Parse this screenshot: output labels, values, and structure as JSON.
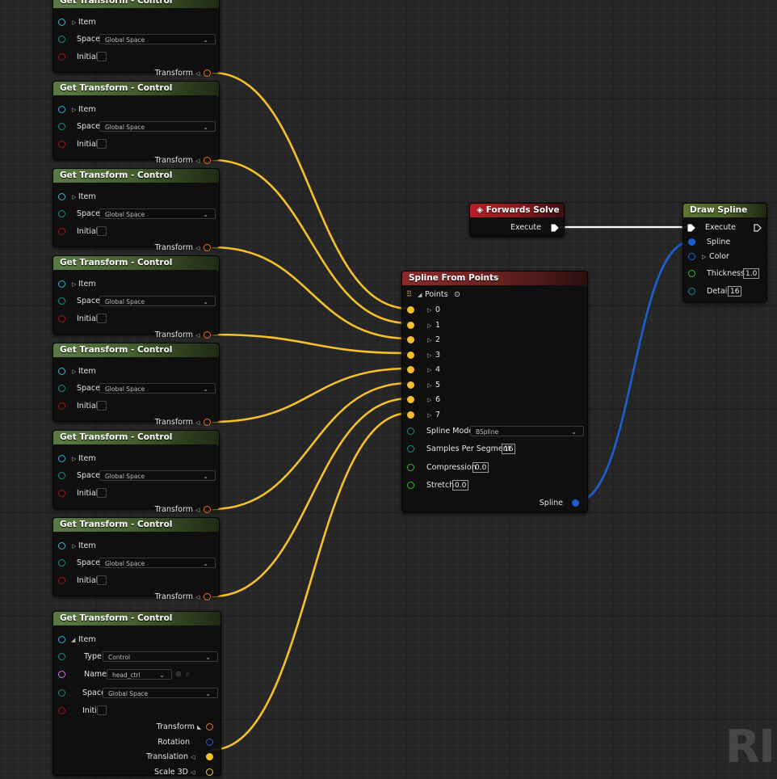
{
  "get_transform_nodes": [
    {
      "title": "Get Transform - Control",
      "item_label": "Item",
      "space_label": "Space",
      "space_value": "Global Space",
      "initial_label": "Initial",
      "transform_label": "Transform"
    },
    {
      "title": "Get Transform - Control",
      "item_label": "Item",
      "space_label": "Space",
      "space_value": "Global Space",
      "initial_label": "Initial",
      "transform_label": "Transform"
    },
    {
      "title": "Get Transform - Control",
      "item_label": "Item",
      "space_label": "Space",
      "space_value": "Global Space",
      "initial_label": "Initial",
      "transform_label": "Transform"
    },
    {
      "title": "Get Transform - Control",
      "item_label": "Item",
      "space_label": "Space",
      "space_value": "Global Space",
      "initial_label": "Initial",
      "transform_label": "Transform"
    },
    {
      "title": "Get Transform - Control",
      "item_label": "Item",
      "space_label": "Space",
      "space_value": "Global Space",
      "initial_label": "Initial",
      "transform_label": "Transform"
    },
    {
      "title": "Get Transform - Control",
      "item_label": "Item",
      "space_label": "Space",
      "space_value": "Global Space",
      "initial_label": "Initial",
      "transform_label": "Transform"
    },
    {
      "title": "Get Transform - Control",
      "item_label": "Item",
      "space_label": "Space",
      "space_value": "Global Space",
      "initial_label": "Initial",
      "transform_label": "Transform"
    }
  ],
  "expanded_node": {
    "title": "Get Transform - Control",
    "item_label": "Item",
    "type_label": "Type",
    "type_value": "Control",
    "name_label": "Name",
    "name_value": "head_ctrl",
    "space_label": "Space",
    "space_value": "Global Space",
    "initial_label": "Initial",
    "transform_label": "Transform",
    "rotation_label": "Rotation",
    "translation_label": "Translation",
    "scale_label": "Scale 3D"
  },
  "forwards_solve": {
    "title": "Forwards Solve",
    "execute_label": "Execute"
  },
  "spline_from_points": {
    "title": "Spline From Points",
    "points_label": "Points",
    "point_items": [
      "0",
      "1",
      "2",
      "3",
      "4",
      "5",
      "6",
      "7"
    ],
    "spline_mode_label": "Spline Mode",
    "spline_mode_value": "BSpline",
    "samples_label": "Samples Per Segment",
    "samples_value": "16",
    "compression_label": "Compression",
    "compression_value": "0.0",
    "stretch_label": "Stretch",
    "stretch_value": "0.0",
    "spline_out_label": "Spline"
  },
  "draw_spline": {
    "title": "Draw Spline",
    "execute_label": "Execute",
    "spline_label": "Spline",
    "color_label": "Color",
    "thickness_label": "Thickness",
    "thickness_value": "1.0",
    "detail_label": "Detail",
    "detail_value": "16"
  },
  "watermark": "RI",
  "colors": {
    "transform_wire": "#f5c12a",
    "spline_wire": "#1d5fd1",
    "exec_wire": "#ffffff",
    "struct_pin": "#ef6b1f",
    "item_pin": "#2fb3d6",
    "bool_pin": "#9b1515",
    "float_pin": "#2fbf2f",
    "name_pin": "#c879e8"
  }
}
